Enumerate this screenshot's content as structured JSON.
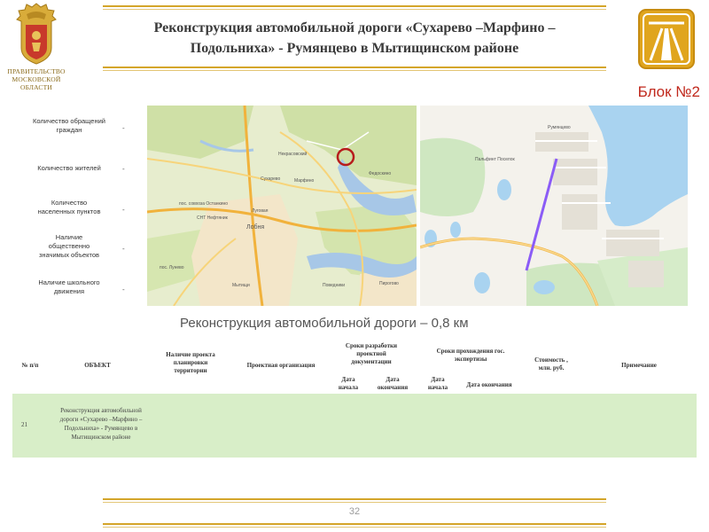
{
  "header": {
    "org_lines": [
      "ПРАВИТЕЛЬСТВО",
      "МОСКОВСКОЙ",
      "ОБЛАСТИ"
    ],
    "title_line1": "Реконструкция автомобильной дороги «Сухарево –Марфино –",
    "title_line2": "Подольниха» - Румянцево в Мытищинском районе",
    "block_label": "Блок №2"
  },
  "stats": [
    {
      "label_lines": [
        "Количество обращений",
        "граждан"
      ],
      "value": "-"
    },
    {
      "label_lines": [
        "Количество жителей"
      ],
      "value": "-"
    },
    {
      "label_lines": [
        "Количество",
        "населенных пунктов"
      ],
      "value": "-"
    },
    {
      "label_lines": [
        "Наличие",
        "общественно",
        "значимых объектов"
      ],
      "value": "-"
    },
    {
      "label_lines": [
        "Наличие школьного",
        "движения"
      ],
      "value": "-"
    }
  ],
  "map1": {
    "labels": [
      "Некрасовский",
      "Сухарево",
      "Марфино",
      "Федоскино",
      "пос. совхоза Останкино",
      "Луговая",
      "СНТ Нефтяник",
      "Лобня",
      "пос. Лунево",
      "Поведники",
      "Пирогово",
      "Мытищи"
    ]
  },
  "map2": {
    "labels": [
      "Румянцево",
      "Пальфинт Поселок"
    ]
  },
  "subtitle": "Реконструкция автомобильной дороги – 0,8 км",
  "table": {
    "headers": {
      "num": "№ п/п",
      "object": "ОБЪЕКТ",
      "planning_lines": [
        "Наличие проекта",
        "планировки",
        "территории"
      ],
      "design_org": "Проектная организация",
      "dev_terms_lines": [
        "Сроки разработки",
        "проектной",
        "документации"
      ],
      "exam_terms_lines": [
        "Сроки прохождения гос.",
        "экспертизы"
      ],
      "start_lines": [
        "Дата",
        "начала"
      ],
      "end_lines": [
        "Дата",
        "окончания"
      ],
      "start2_lines": [
        "Дата",
        "начала"
      ],
      "end2": "Дата окончания",
      "cost_lines": [
        "Стоимость ,",
        "млн. руб."
      ],
      "note": "Примечание"
    },
    "row": {
      "num": "21",
      "object_lines": [
        "Реконструкция автомобильной",
        "дороги «Сухарево –Марфино –",
        "Подольниха» - Румянцево в",
        "Мытищинском районе"
      ]
    }
  },
  "footer": {
    "page": "32"
  },
  "colors": {
    "gold": "#d4a52a",
    "block_label": "#c0281c",
    "row_bg": "#d8eec8",
    "route": "#8b5cf6"
  }
}
